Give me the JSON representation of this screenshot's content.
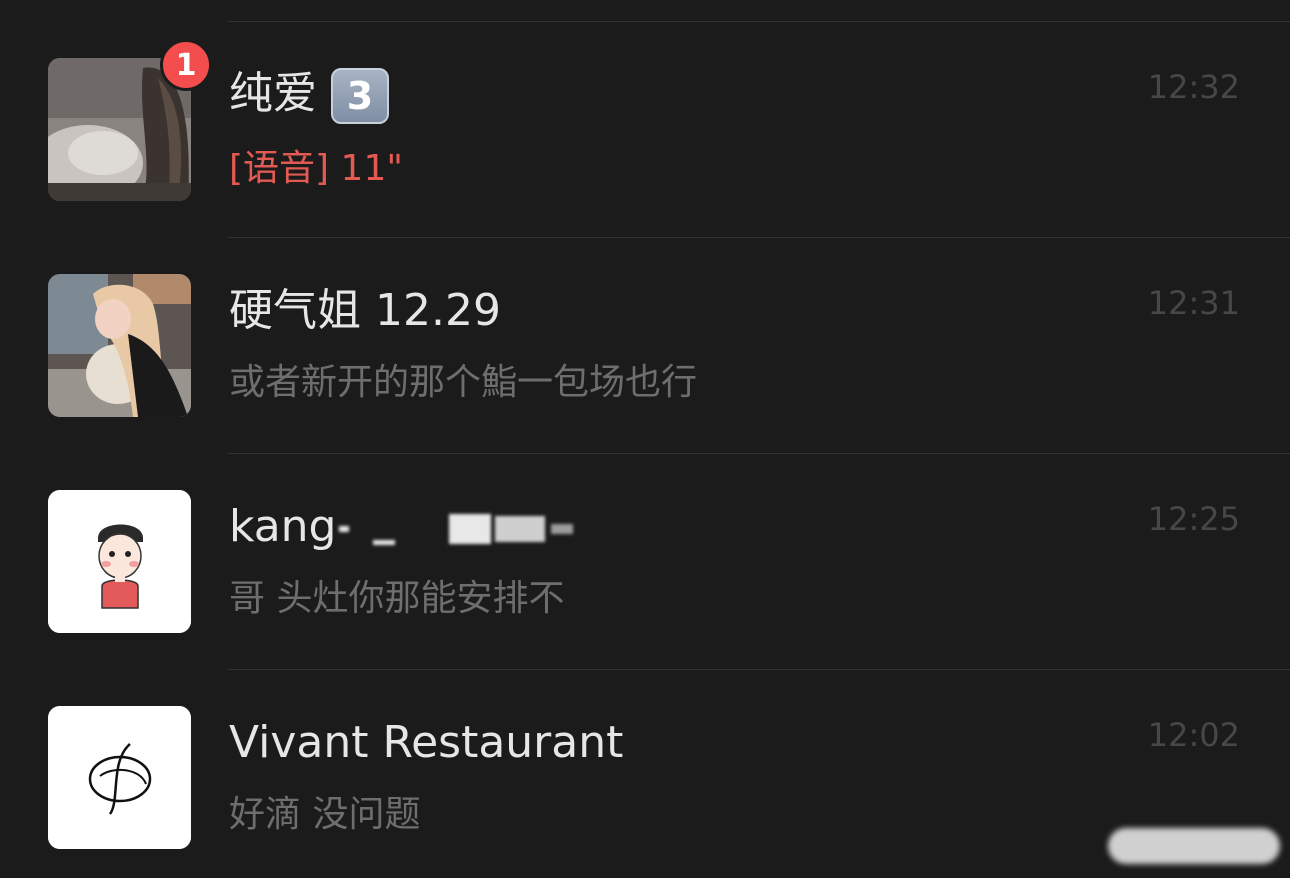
{
  "chats": [
    {
      "name": "纯爱",
      "name_emoji": "3",
      "preview": "[语音] 11\"",
      "time": "12:32",
      "unread": "1",
      "avatar_icon": "photo-avatar-girl"
    },
    {
      "name": "硬气姐 12.29",
      "preview": "或者新开的那个鮨一包场也行",
      "time": "12:31",
      "avatar_icon": "photo-avatar-woman-with-cat"
    },
    {
      "name": "kang",
      "preview": "哥 头灶你那能安排不",
      "time": "12:25",
      "avatar_icon": "cartoon-boy-avatar"
    },
    {
      "name": "Vivant Restaurant",
      "preview": "好滴 没问题",
      "time": "12:02",
      "avatar_icon": "vivant-logo-avatar"
    }
  ],
  "colors": {
    "background": "#1b1b1c",
    "name_text": "#e6e6e6",
    "preview_text": "#6e6e70",
    "voice_text": "#e25a52",
    "time_text": "#47474a",
    "badge": "#f34d4d",
    "divider": "#333335"
  }
}
